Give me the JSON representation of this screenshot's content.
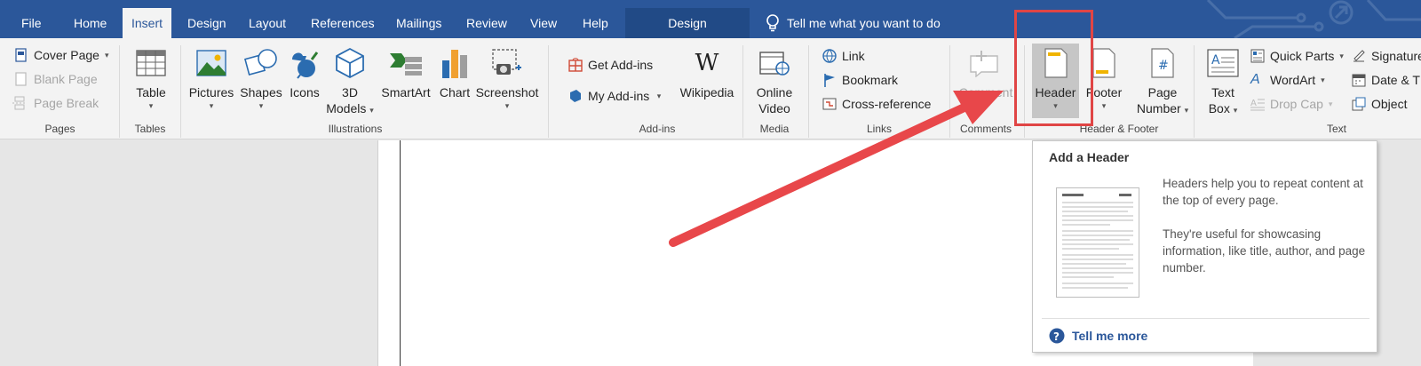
{
  "tabs": {
    "file": "File",
    "home": "Home",
    "insert": "Insert",
    "design": "Design",
    "layout": "Layout",
    "references": "References",
    "mailings": "Mailings",
    "review": "Review",
    "view": "View",
    "help": "Help",
    "context_design": "Design",
    "tell_me": "Tell me what you want to do"
  },
  "pages_group": {
    "label": "Pages",
    "cover_page": "Cover Page",
    "blank_page": "Blank Page",
    "page_break": "Page Break"
  },
  "tables_group": {
    "label": "Tables",
    "table": "Table"
  },
  "illustrations_group": {
    "label": "Illustrations",
    "pictures": "Pictures",
    "shapes": "Shapes",
    "icons": "Icons",
    "models_3d_line1": "3D",
    "models_3d_line2": "Models",
    "smartart": "SmartArt",
    "chart": "Chart",
    "screenshot": "Screenshot"
  },
  "addins_group": {
    "label": "Add-ins",
    "get_addins": "Get Add-ins",
    "my_addins": "My Add-ins",
    "wikipedia": "Wikipedia"
  },
  "media_group": {
    "label": "Media",
    "online_video_line1": "Online",
    "online_video_line2": "Video"
  },
  "links_group": {
    "label": "Links",
    "link": "Link",
    "bookmark": "Bookmark",
    "cross_reference": "Cross-reference"
  },
  "comments_group": {
    "label": "Comments",
    "comment": "Comment"
  },
  "header_footer_group": {
    "label": "Header & Footer",
    "header": "Header",
    "footer": "Footer",
    "page_number_line1": "Page",
    "page_number_line2": "Number"
  },
  "text_group": {
    "label": "Text",
    "text_box_line1": "Text",
    "text_box_line2": "Box",
    "quick_parts": "Quick Parts",
    "wordart": "WordArt",
    "drop_cap": "Drop Cap",
    "signature": "Signature",
    "date_time": "Date & T",
    "object": "Object"
  },
  "tooltip": {
    "title": "Add a Header",
    "para1": "Headers help you to repeat content at the top of every page.",
    "para2": "They're useful for showcasing information, like title, author, and page number.",
    "tell_more": "Tell me more"
  },
  "colors": {
    "title_bar": "#2b579a",
    "ribbon": "#f3f3f3",
    "highlight": "#e04545",
    "arrow": "#e8474a"
  }
}
